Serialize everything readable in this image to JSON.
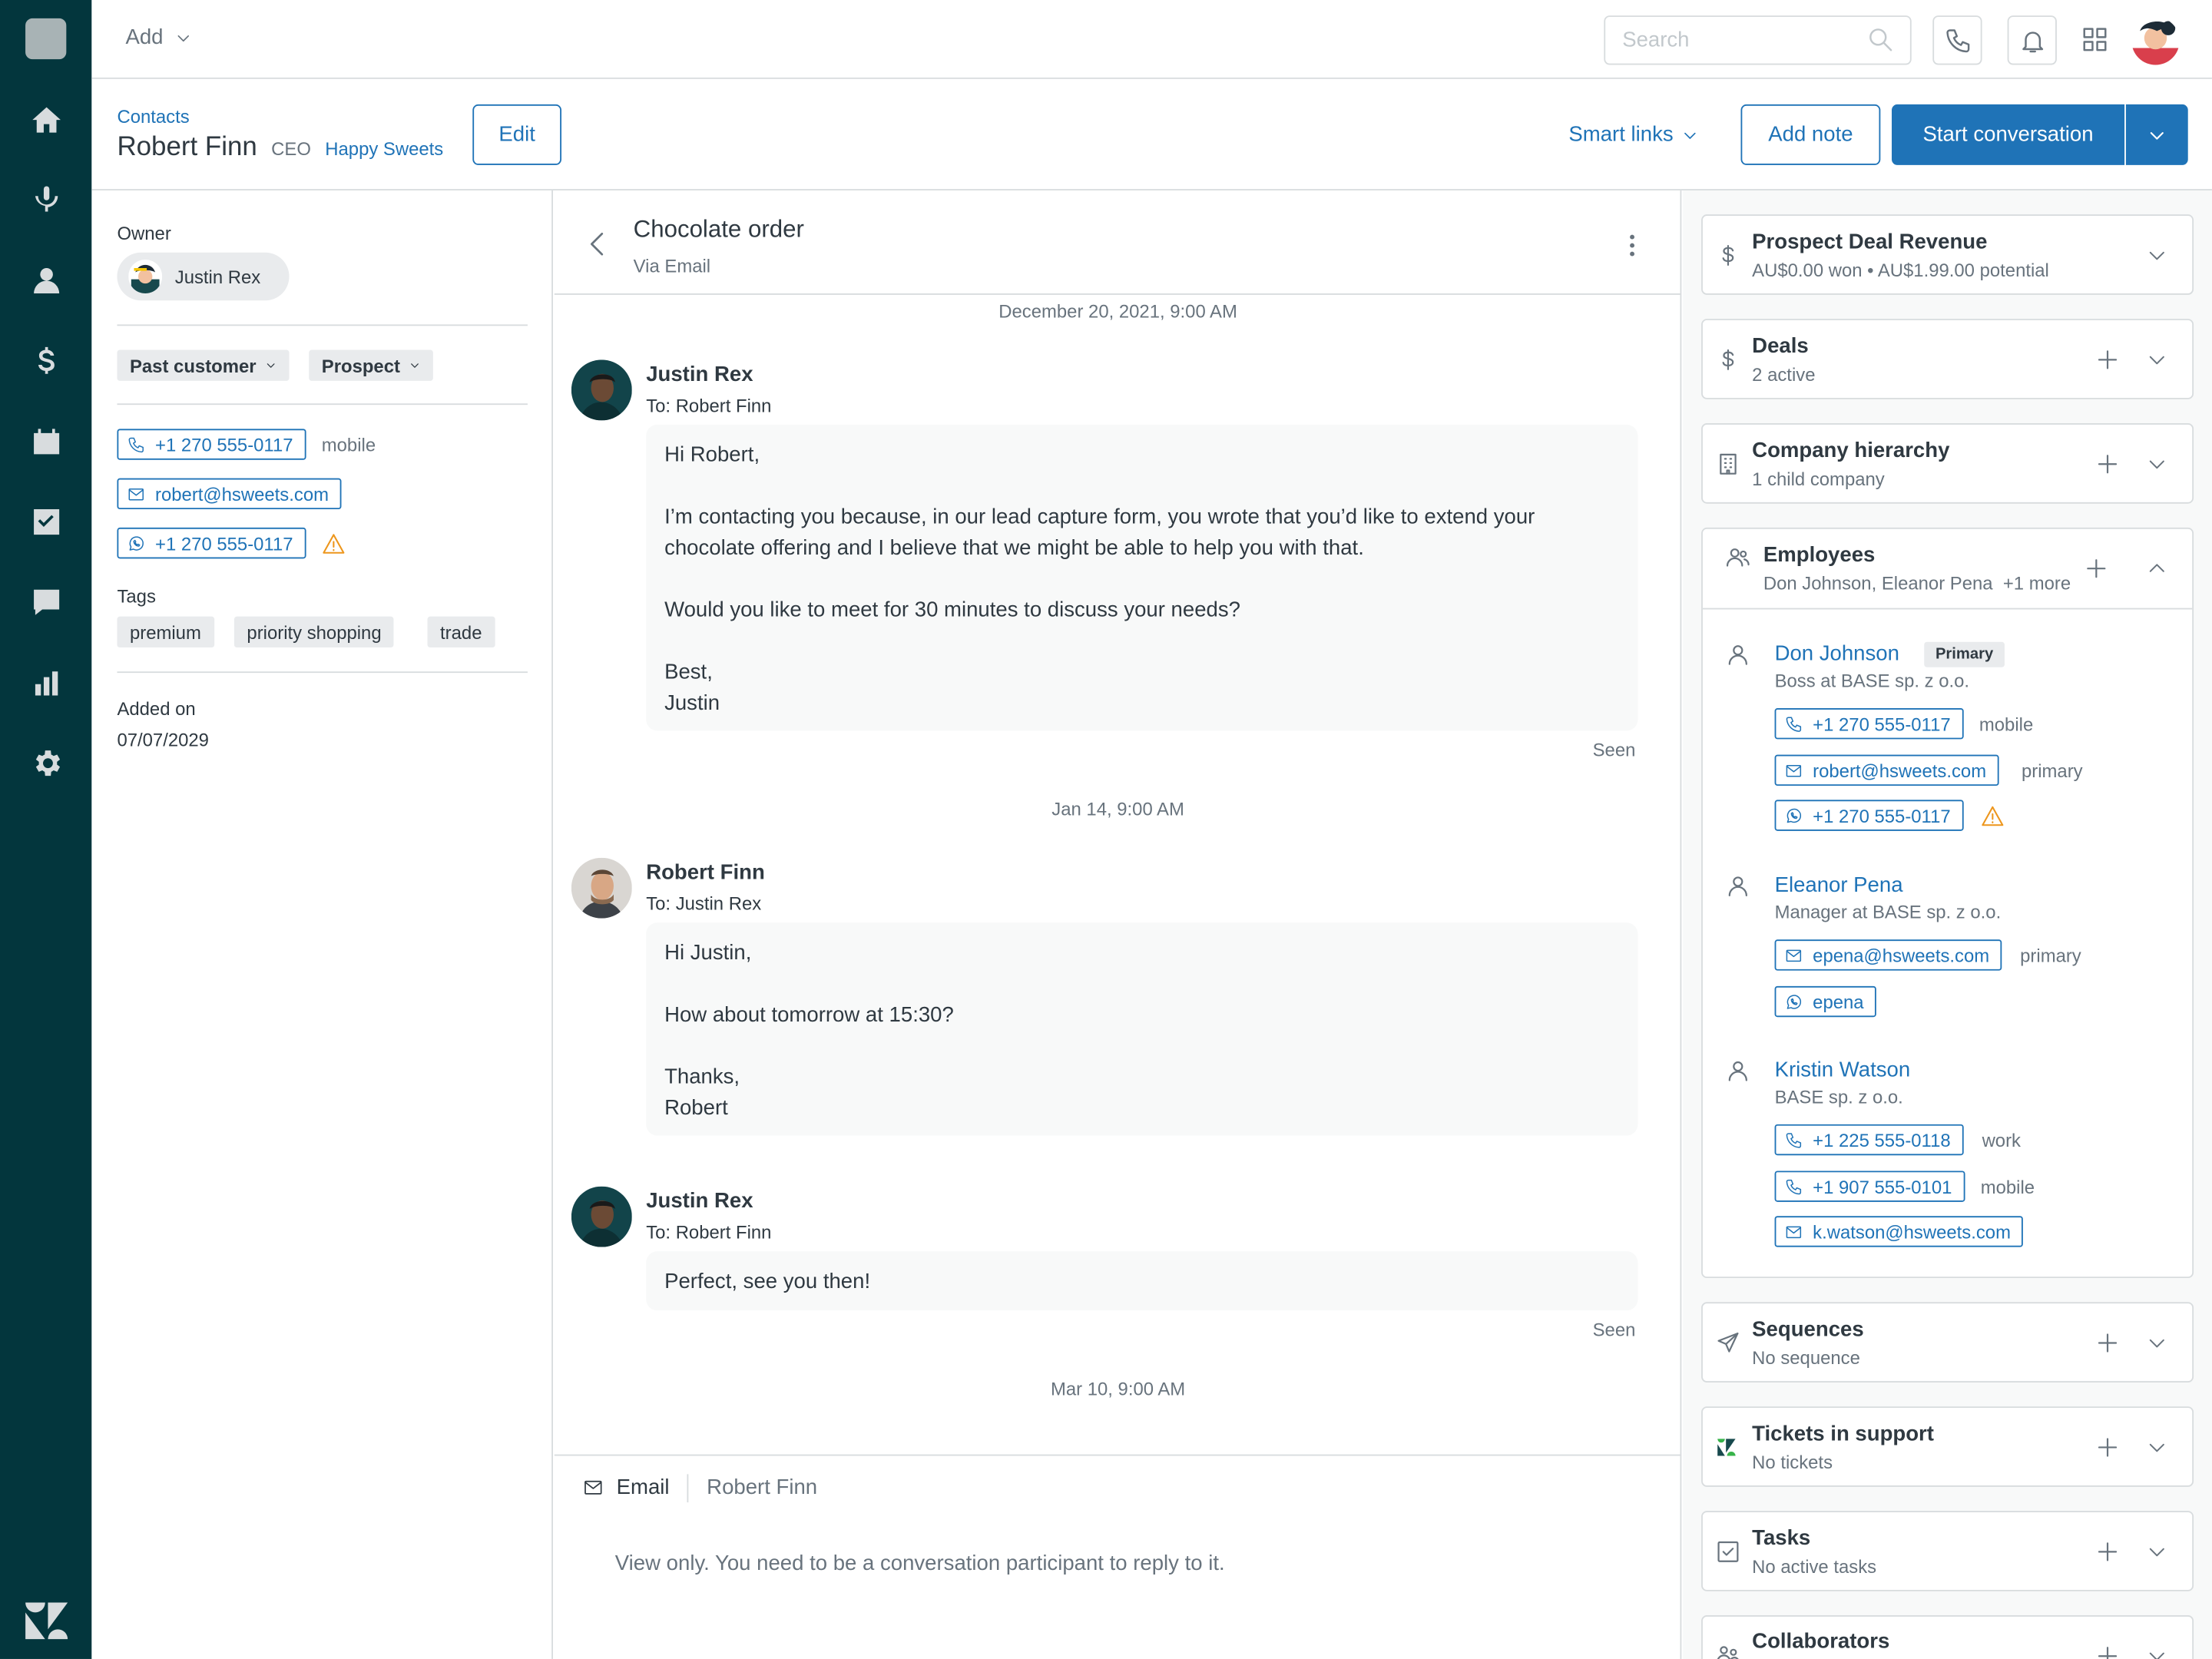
{
  "topbar": {
    "add_label": "Add",
    "search_placeholder": "Search"
  },
  "header": {
    "breadcrumb": "Contacts",
    "name": "Robert Finn",
    "role": "CEO",
    "company": "Happy Sweets",
    "edit_label": "Edit",
    "smart_links_label": "Smart links",
    "add_note_label": "Add note",
    "start_conversation_label": "Start conversation"
  },
  "contact": {
    "owner_label": "Owner",
    "owner_name": "Justin Rex",
    "statuses": [
      "Past customer",
      "Prospect"
    ],
    "phone": {
      "value": "+1 270 555-0117",
      "note": "mobile"
    },
    "email": {
      "value": "robert@hsweets.com"
    },
    "whatsapp": {
      "value": "+1 270 555-0117"
    },
    "tags_label": "Tags",
    "tags": [
      "premium",
      "priority shopping",
      "trade"
    ],
    "added_label": "Added on",
    "added_value": "07/07/2029"
  },
  "conversation": {
    "title": "Chocolate order",
    "channel": "Via Email",
    "timestamps": [
      "December 20, 2021, 9:00 AM",
      "Jan 14, 9:00 AM",
      "Mar 10, 9:00 AM"
    ],
    "seen_label": "Seen",
    "messages": [
      {
        "from": "Justin Rex",
        "to": "To: Robert Finn",
        "lines": [
          "Hi Robert,",
          "",
          "I’m contacting you because, in our lead capture form, you wrote that you’d like to extend your chocolate offering and I believe that we might be able to help you with that.",
          "",
          "Would you like to meet for 30 minutes to discuss your needs?",
          "",
          "Best,",
          "Justin"
        ]
      },
      {
        "from": "Robert Finn",
        "to": "To: Justin Rex",
        "lines": [
          "Hi Justin,",
          "",
          "How about tomorrow at 15:30?",
          "",
          "Thanks,",
          "Robert"
        ]
      },
      {
        "from": "Justin Rex",
        "to": "To: Robert Finn",
        "lines": [
          "Perfect, see you then!"
        ]
      }
    ],
    "composer": {
      "channel": "Email",
      "recipient": "Robert Finn",
      "message": "View only. You need to be a conversation participant to reply to it."
    }
  },
  "cards": {
    "revenue": {
      "title": "Prospect Deal Revenue",
      "sub": "AU$0.00 won • AU$1.99.00 potential"
    },
    "deals": {
      "title": "Deals",
      "sub": "2 active"
    },
    "hierarchy": {
      "title": "Company hierarchy",
      "sub": "1 child company"
    },
    "employees": {
      "title": "Employees",
      "sub": "Don Johnson, Eleanor Pena",
      "more": "+1 more",
      "list": [
        {
          "name": "Don Johnson",
          "badge": "Primary",
          "title": "Boss at BASE sp. z o.o.",
          "phone": "+1 270 555-0117",
          "phone_note": "mobile",
          "email": "robert@hsweets.com",
          "email_note": "primary",
          "whatsapp": "+1 270 555-0117"
        },
        {
          "name": "Eleanor Pena",
          "title": "Manager at BASE sp. z o.o.",
          "email": "epena@hsweets.com",
          "email_note": "primary",
          "whatsapp": "epena"
        },
        {
          "name": "Kristin Watson",
          "title": "BASE sp. z o.o.",
          "phone": "+1 225 555-0118",
          "phone_note": "work",
          "phone2": "+1 907 555-0101",
          "phone2_note": "mobile",
          "email": "k.watson@hsweets.com"
        }
      ]
    },
    "sequences": {
      "title": "Sequences",
      "sub": "No sequence"
    },
    "tickets": {
      "title": "Tickets in support",
      "sub": "No tickets"
    },
    "tasks": {
      "title": "Tasks",
      "sub": "No active tasks"
    },
    "collaborators": {
      "title": "Collaborators"
    }
  },
  "colors": {
    "sidebar": "#03363d",
    "accent": "#1f73b7",
    "warning": "#ed961c",
    "zendesk_green": "#17494d"
  }
}
